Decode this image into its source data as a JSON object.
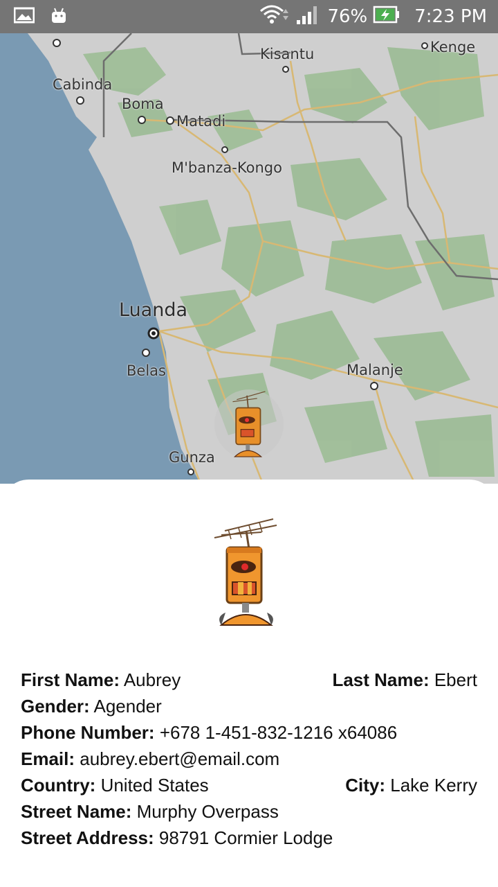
{
  "status_bar": {
    "battery_percent": "76%",
    "time": "7:23 PM",
    "icons": [
      "image-notification-icon",
      "android-notification-icon",
      "wifi-icon",
      "cell-signal-icon",
      "battery-charging-icon"
    ]
  },
  "map": {
    "labels": {
      "kisantu": "Kisantu",
      "kenge": "Kenge",
      "cabinda": "Cabinda",
      "boma": "Boma",
      "matadi": "Matadi",
      "mbanza": "M'banza-Kongo",
      "luanda": "Luanda",
      "belas": "Belas",
      "malanje": "Malanje",
      "gunza": "Gunza"
    },
    "colors": {
      "ocean": "#7a9ab3",
      "land": "#cfcfcf",
      "forest": "#9cbc95",
      "roads": "#d8b873"
    }
  },
  "profile": {
    "first_name_label": "First Name:",
    "first_name": "Aubrey",
    "last_name_label": "Last Name:",
    "last_name": "Ebert",
    "gender_label": "Gender:",
    "gender": "Agender",
    "phone_label": "Phone Number:",
    "phone": "+678 1-451-832-1216 x64086",
    "email_label": "Email:",
    "email": "aubrey.ebert@email.com",
    "country_label": "Country:",
    "country": "United States",
    "city_label": "City:",
    "city": "Lake Kerry",
    "street_name_label": "Street Name:",
    "street_name": "Murphy Overpass",
    "street_address_label": "Street Address:",
    "street_address": "98791 Cormier Lodge"
  }
}
